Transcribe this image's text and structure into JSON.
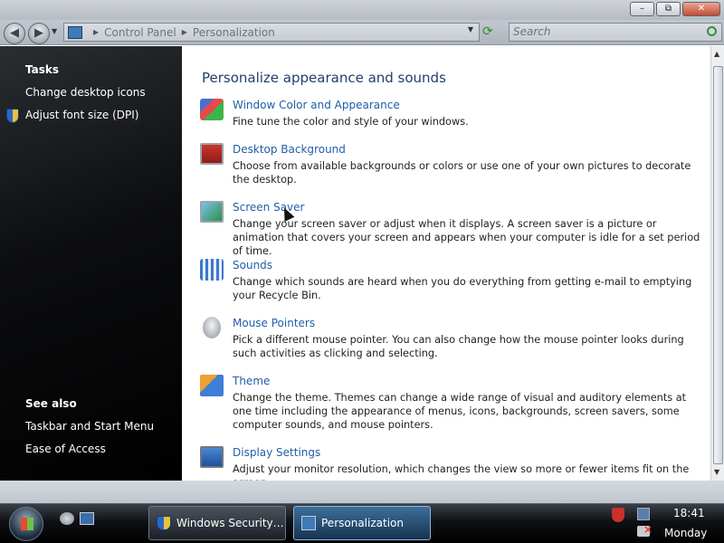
{
  "window": {
    "minimize_label": "–",
    "maximize_label": "⧉",
    "close_label": "✕"
  },
  "nav": {
    "breadcrumb": [
      "Control Panel",
      "Personalization"
    ],
    "search_placeholder": "Search"
  },
  "leftpane": {
    "tasks_title": "Tasks",
    "tasks": [
      "Change desktop icons",
      "Adjust font size (DPI)"
    ],
    "see_also_title": "See also",
    "see_also": [
      "Taskbar and Start Menu",
      "Ease of Access"
    ]
  },
  "content": {
    "heading": "Personalize appearance and sounds",
    "items": [
      {
        "title": "Window Color and Appearance",
        "desc": "Fine tune the color and style of your windows.",
        "icon": "window-color-icon"
      },
      {
        "title": "Desktop Background",
        "desc": "Choose from available backgrounds or colors or use one of your own pictures to decorate the desktop.",
        "icon": "desktop-background-icon"
      },
      {
        "title": "Screen Saver",
        "desc": "Change your screen saver or adjust when it displays. A screen saver is a picture or animation that covers your screen and appears when your computer is idle for a set period of time.",
        "icon": "screen-saver-icon"
      },
      {
        "title": "Sounds",
        "desc": "Change which sounds are heard when you do everything from getting e-mail to emptying your Recycle Bin.",
        "icon": "sounds-icon"
      },
      {
        "title": "Mouse Pointers",
        "desc": "Pick a different mouse pointer. You can also change how the mouse pointer looks during such activities as clicking and selecting.",
        "icon": "mouse-icon"
      },
      {
        "title": "Theme",
        "desc": "Change the theme. Themes can change a wide range of visual and auditory elements at one time including the appearance of menus, icons, backgrounds, screen savers, some computer sounds, and mouse pointers.",
        "icon": "theme-icon"
      },
      {
        "title": "Display Settings",
        "desc": "Adjust your monitor resolution, which changes the view so more or fewer items fit on the screen.",
        "icon": "display-icon"
      }
    ]
  },
  "taskbar": {
    "tasks": [
      "Windows Security C...",
      "Personalization"
    ],
    "time": "18:41",
    "day": "Monday"
  }
}
